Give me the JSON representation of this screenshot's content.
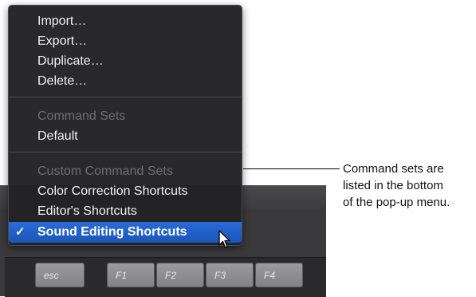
{
  "menu": {
    "file_items": [
      "Import…",
      "Export…",
      "Duplicate…",
      "Delete…"
    ],
    "command_sets_header": "Command Sets",
    "default_item": "Default",
    "custom_header": "Custom Command Sets",
    "custom_items": [
      "Color Correction Shortcuts",
      "Editor's Shortcuts"
    ],
    "selected_item": "Sound Editing Shortcuts",
    "checkmark": "✓"
  },
  "keyboard": {
    "keys": [
      "esc",
      "F1",
      "F2",
      "F3",
      "F4"
    ]
  },
  "callout": {
    "line1": "Command sets are",
    "line2": "listed in the bottom",
    "line3": "of the pop-up menu."
  },
  "colors": {
    "selection": "#1f5fc8",
    "menu_bg": "#222224"
  },
  "icons": {
    "cursor": "arrow-pointer-icon",
    "check": "checkmark-icon"
  }
}
